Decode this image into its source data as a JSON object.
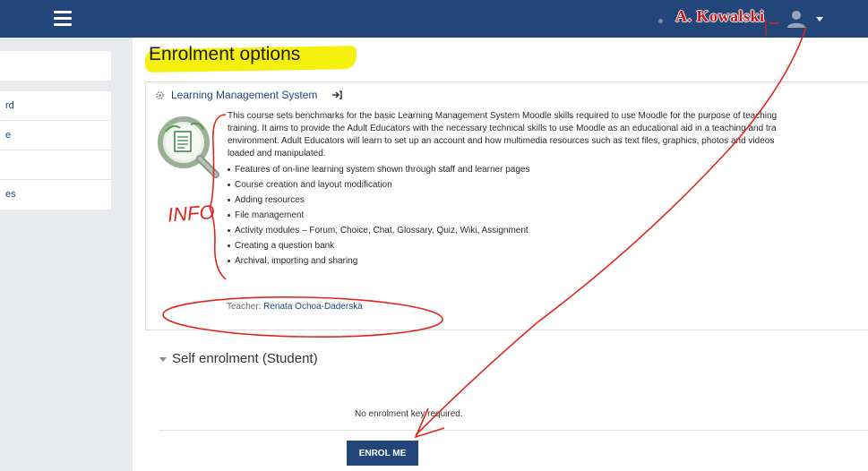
{
  "topbar": {
    "user_name": "A. Kowalski",
    "bg_color": "#22467a"
  },
  "drawer": {
    "items": [
      "rd",
      "e",
      "",
      "es"
    ]
  },
  "page": {
    "title": "Enrolment options",
    "highlight_color": "#f4f000"
  },
  "course": {
    "name": "Learning Management System",
    "summary_lines": [
      "This course sets benchmarks for the basic Learning Management System Moodle skills required to use Moodle for the purpose of teaching",
      "training. It aims to provide the Adult Educators with the necessary technical skills to use Moodle as an educational aid in a teaching and tra",
      "environment.  Adult Educators will learn to set up an account and how multimedia resources such as text files, graphics, photos and videos",
      "loaded and manipulated."
    ],
    "topics": [
      "Features of on-line learning system shown through staff and learner pages",
      "Course creation and layout modification",
      "Adding resources",
      "File management",
      "Activity modules – Forum, Choice, Chat, Glossary, Quiz, Wiki, Assignment",
      "Creating a question bank",
      "Archival, importing and sharing"
    ],
    "teacher_label": "Teacher: ",
    "teacher_name": "Renata Ochoa-Daderska"
  },
  "enrol": {
    "heading": "Self enrolment (Student)",
    "no_key_text": "No enrolment key required.",
    "button_label": "ENROL ME"
  },
  "annotation": {
    "info_label": "INFO",
    "ink_color": "#e0261e"
  }
}
